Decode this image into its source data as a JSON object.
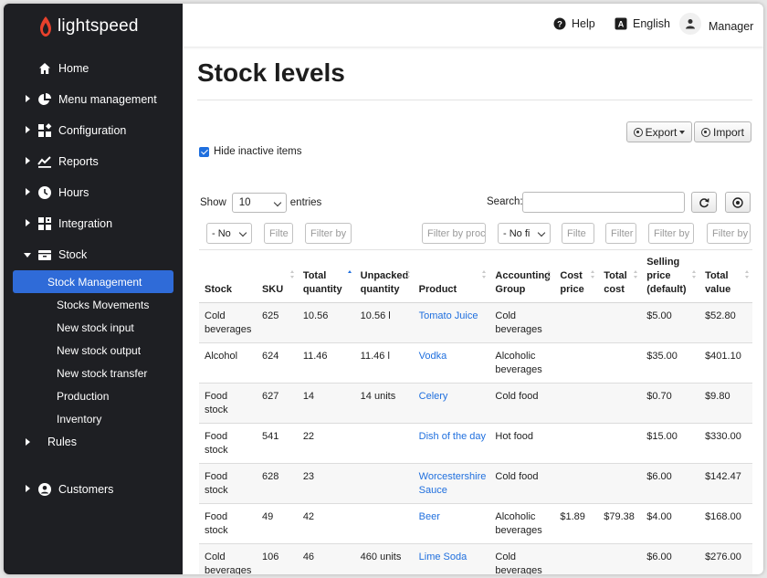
{
  "brand": {
    "name": "lightspeed",
    "logo_color": "#e8412c"
  },
  "sidebar": {
    "items": [
      {
        "label": "Home",
        "icon": "home-icon",
        "caret": "none"
      },
      {
        "label": "Menu management",
        "icon": "pie-chart-icon",
        "caret": "right"
      },
      {
        "label": "Configuration",
        "icon": "widgets-icon",
        "caret": "right"
      },
      {
        "label": "Reports",
        "icon": "trend-line-icon",
        "caret": "right"
      },
      {
        "label": "Hours",
        "icon": "clock-icon",
        "caret": "right"
      },
      {
        "label": "Integration",
        "icon": "puzzle-grid-icon",
        "caret": "right"
      },
      {
        "label": "Stock",
        "icon": "stock-box-icon",
        "caret": "down"
      }
    ],
    "stock_subitems": [
      "Stock Management",
      "Stocks Movements",
      "New stock input",
      "New stock output",
      "New stock transfer",
      "Production",
      "Inventory"
    ],
    "rules": {
      "label": "Rules"
    },
    "customers": {
      "label": "Customers",
      "icon": "user-circle-icon"
    },
    "active_color": "#2f6bd8"
  },
  "topbar": {
    "help": "Help",
    "language": "English",
    "user": "Manager"
  },
  "page": {
    "title": "Stock levels",
    "export_label": "Export",
    "import_label": "Import",
    "hide_inactive_label": "Hide inactive items",
    "show_label": "Show",
    "entries_value": "10",
    "entries_label": "entries",
    "search_label": "Search:",
    "search_value": ""
  },
  "filters": [
    {
      "text": "- No",
      "type": "select"
    },
    {
      "text": "Filte",
      "type": "input"
    },
    {
      "text": "Filter by",
      "type": "input"
    },
    {
      "text": "Filter by proc",
      "type": "input"
    },
    {
      "text": "- No fi",
      "type": "select"
    },
    {
      "text": "Filte",
      "type": "input"
    },
    {
      "text": "Filter",
      "type": "input"
    },
    {
      "text": "Filter by",
      "type": "input"
    },
    {
      "text": "Filter by",
      "type": "input"
    }
  ],
  "table": {
    "columns": [
      {
        "label": "Stock",
        "sort": "none"
      },
      {
        "label": "SKU",
        "sort": "both"
      },
      {
        "label": "Total quantity",
        "sort": "asc"
      },
      {
        "label": "Unpacked quantity",
        "sort": "both"
      },
      {
        "label": "Product",
        "sort": "both"
      },
      {
        "label": "Accounting Group",
        "sort": "both"
      },
      {
        "label": "Cost price",
        "sort": "both"
      },
      {
        "label": "Total cost",
        "sort": "both"
      },
      {
        "label": "Selling price (default)",
        "sort": "both"
      },
      {
        "label": "Total value",
        "sort": "both"
      }
    ],
    "rows": [
      {
        "stock": "Cold beverages",
        "sku": "625",
        "total_qty": "10.56",
        "unpacked": "10.56 l",
        "product": "Tomato Juice",
        "group": "Cold beverages",
        "cost": "",
        "total_cost": "",
        "selling": "$5.00",
        "total_value": "$52.80"
      },
      {
        "stock": "Alcohol",
        "sku": "624",
        "total_qty": "11.46",
        "unpacked": "11.46 l",
        "product": "Vodka",
        "group": "Alcoholic beverages",
        "cost": "",
        "total_cost": "",
        "selling": "$35.00",
        "total_value": "$401.10"
      },
      {
        "stock": "Food stock",
        "sku": "627",
        "total_qty": "14",
        "unpacked": "14 units",
        "product": "Celery",
        "group": "Cold food",
        "cost": "",
        "total_cost": "",
        "selling": "$0.70",
        "total_value": "$9.80"
      },
      {
        "stock": "Food stock",
        "sku": "541",
        "total_qty": "22",
        "unpacked": "",
        "product": "Dish of the day",
        "group": "Hot food",
        "cost": "",
        "total_cost": "",
        "selling": "$15.00",
        "total_value": "$330.00"
      },
      {
        "stock": "Food stock",
        "sku": "628",
        "total_qty": "23",
        "unpacked": "",
        "product": "Worcestershire Sauce",
        "group": "Cold food",
        "cost": "",
        "total_cost": "",
        "selling": "$6.00",
        "total_value": "$142.47"
      },
      {
        "stock": "Food stock",
        "sku": "49",
        "total_qty": "42",
        "unpacked": "",
        "product": "Beer",
        "group": "Alcoholic beverages",
        "cost": "$1.89",
        "total_cost": "$79.38",
        "selling": "$4.00",
        "total_value": "$168.00"
      },
      {
        "stock": "Cold beverages",
        "sku": "106",
        "total_qty": "46",
        "unpacked": "460 units",
        "product": "Lime Soda",
        "group": "Cold beverages",
        "cost": "",
        "total_cost": "",
        "selling": "$6.00",
        "total_value": "$276.00"
      }
    ]
  },
  "colors": {
    "link": "#1f6fde",
    "sidebar_bg": "#1e1f23"
  }
}
